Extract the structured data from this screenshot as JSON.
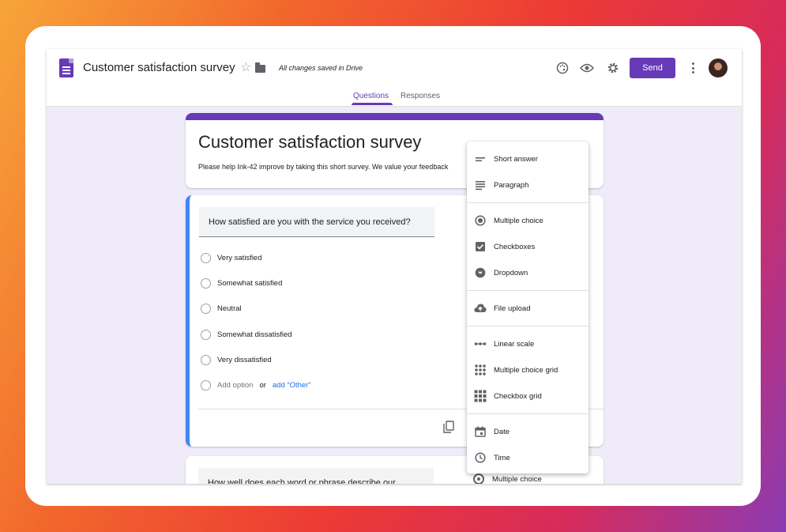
{
  "header": {
    "doc_title": "Customer satisfaction survey",
    "saved_status": "All changes saved in Drive",
    "send_label": "Send",
    "icons": [
      "palette-icon",
      "preview-eye-icon",
      "settings-gear-icon",
      "more-vert-icon"
    ]
  },
  "tabs": [
    {
      "label": "Questions",
      "active": true
    },
    {
      "label": "Responses",
      "active": false
    }
  ],
  "form": {
    "title": "Customer satisfaction survey",
    "description": "Please help Ink-42 improve by taking this short survey. We value your feedback"
  },
  "question1": {
    "title": "How satisfied are you with the service you received?",
    "options": [
      "Very satisfied",
      "Somewhat satisfied",
      "Neutral",
      "Somewhat dissatisfied",
      "Very dissatisfied"
    ],
    "add_option": "Add option",
    "or_word": "or",
    "add_other": "add “Other”"
  },
  "question2": {
    "title": "How well does each word or phrase describe our",
    "type_label": "Multiple choice"
  },
  "type_menu": {
    "items": [
      {
        "label": "Short answer",
        "icon": "short-text-icon"
      },
      {
        "label": "Paragraph",
        "icon": "paragraph-icon"
      },
      {
        "label": "Multiple choice",
        "icon": "radio-checked-icon"
      },
      {
        "label": "Checkboxes",
        "icon": "checkbox-icon"
      },
      {
        "label": "Dropdown",
        "icon": "dropdown-icon"
      },
      {
        "label": "File upload",
        "icon": "cloud-upload-icon"
      },
      {
        "label": "Linear scale",
        "icon": "linear-scale-icon"
      },
      {
        "label": "Multiple choice grid",
        "icon": "dot-grid-icon"
      },
      {
        "label": "Checkbox grid",
        "icon": "checkbox-grid-icon"
      },
      {
        "label": "Date",
        "icon": "calendar-icon"
      },
      {
        "label": "Time",
        "icon": "clock-icon"
      }
    ]
  },
  "colors": {
    "brand": "#673ab7",
    "canvas": "#f0ebf8",
    "focus_bar": "#4285f4",
    "link": "#1a73e8"
  }
}
